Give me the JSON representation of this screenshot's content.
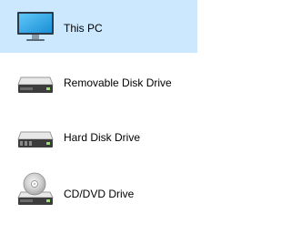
{
  "colors": {
    "selected_background": "#cce8ff",
    "text": "#000000"
  },
  "items": [
    {
      "label": "This PC",
      "icon": "monitor-icon",
      "selected": true
    },
    {
      "label": "Removable Disk Drive",
      "icon": "removable-drive-icon",
      "selected": false
    },
    {
      "label": "Hard Disk Drive",
      "icon": "hard-drive-icon",
      "selected": false
    },
    {
      "label": "CD/DVD Drive",
      "icon": "cd-dvd-drive-icon",
      "selected": false
    }
  ]
}
